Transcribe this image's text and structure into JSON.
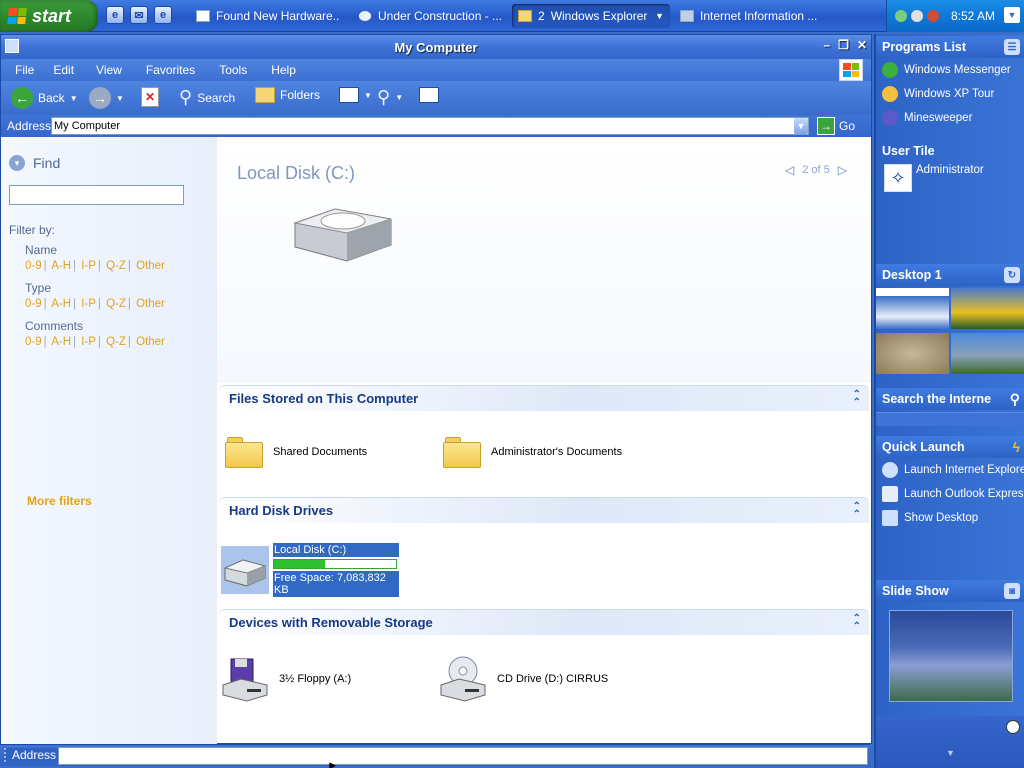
{
  "taskbar": {
    "start_label": "start",
    "tasks": [
      {
        "label": "Found New Hardware..."
      },
      {
        "label": "Under Construction - ..."
      },
      {
        "label": "Windows Explorer",
        "count": "2"
      },
      {
        "label": "Internet Information ..."
      }
    ],
    "clock": "8:52 AM"
  },
  "window": {
    "title": "My Computer",
    "menu": [
      "File",
      "Edit",
      "View",
      "Favorites",
      "Tools",
      "Help"
    ],
    "toolbar": {
      "back": "Back",
      "search": "Search",
      "folders": "Folders"
    },
    "address_label": "Address",
    "address_value": "My Computer",
    "go_label": "Go"
  },
  "left": {
    "find_label": "Find",
    "filter_by": "Filter by:",
    "groups": [
      {
        "name": "Name",
        "links": [
          "0-9",
          "A-H",
          "I-P",
          "Q-Z",
          "Other"
        ]
      },
      {
        "name": "Type",
        "links": [
          "0-9",
          "A-H",
          "I-P",
          "Q-Z",
          "Other"
        ]
      },
      {
        "name": "Comments",
        "links": [
          "0-9",
          "A-H",
          "I-P",
          "Q-Z",
          "Other"
        ]
      }
    ],
    "more_filters": "More filters"
  },
  "content": {
    "hero_title": "Local Disk (C:)",
    "pager": "2 of 5",
    "sections": [
      {
        "title": "Files Stored on This Computer",
        "items": [
          "Shared Documents",
          "Administrator's Documents"
        ]
      },
      {
        "title": "Hard Disk Drives",
        "items": [
          "Local Disk (C:)"
        ],
        "free_space": "Free Space: 7,083,832 KB",
        "used_fraction": 0.42
      },
      {
        "title": "Devices with Removable Storage",
        "items": [
          "3½ Floppy (A:)",
          "CD Drive (D:) CIRRUS"
        ]
      }
    ]
  },
  "bottom_address_label": "Address",
  "sidebar": {
    "programs_title": "Programs List",
    "programs": [
      "Windows Messenger",
      "Windows XP Tour",
      "Minesweeper"
    ],
    "user_title": "User Tile",
    "user_name": "Administrator",
    "desktop_title": "Desktop 1",
    "search_title": "Search the Interne",
    "quick_title": "Quick Launch",
    "quick": [
      "Launch Internet Explore",
      "Launch Outlook Express",
      "Show Desktop"
    ],
    "slideshow_title": "Slide Show"
  }
}
